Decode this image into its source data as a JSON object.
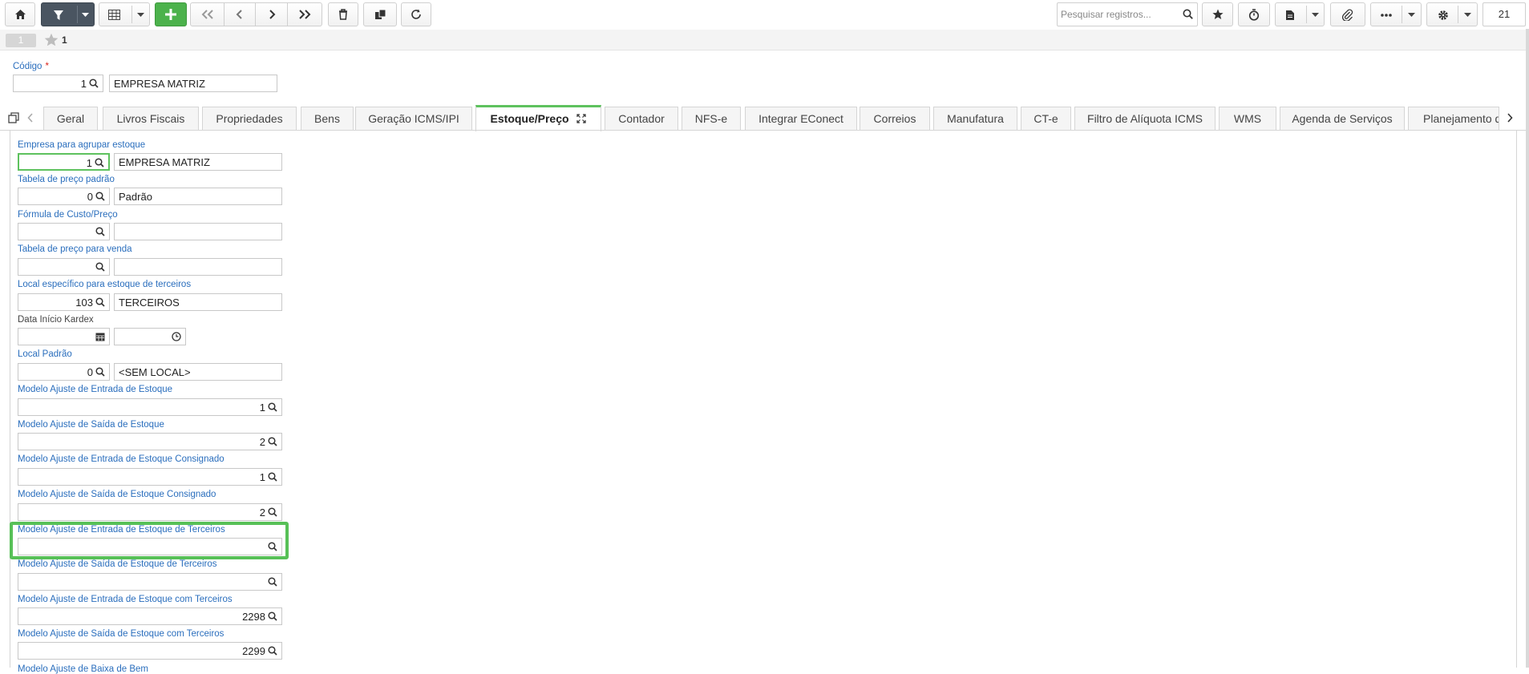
{
  "toolbar": {
    "search_placeholder": "Pesquisar registros...",
    "record_count": "21",
    "icons": [
      "home-icon",
      "filter-icon",
      "grid-icon",
      "plus-icon",
      "first-icon",
      "prev-icon",
      "next-icon",
      "last-icon",
      "trash-icon",
      "copy-icon",
      "refresh-icon",
      "star-icon",
      "stopwatch-icon",
      "report-icon",
      "paperclip-icon",
      "ellipsis-icon",
      "gear-icon"
    ]
  },
  "record_bar": {
    "pill": "1",
    "favorite_count": "1"
  },
  "header": {
    "codigo_label": "Código",
    "required_mark": "*",
    "codigo_value": "1",
    "codigo_desc": "EMPRESA MATRIZ"
  },
  "tabs": [
    {
      "label": "Geral"
    },
    {
      "label": "Livros Fiscais"
    },
    {
      "label": "Propriedades"
    },
    {
      "label": "Bens"
    },
    {
      "label": "Geração ICMS/IPI"
    },
    {
      "label": "Estoque/Preço",
      "active": true
    },
    {
      "label": "Contador"
    },
    {
      "label": "NFS-e"
    },
    {
      "label": "Integrar EConect"
    },
    {
      "label": "Correios"
    },
    {
      "label": "Manufatura"
    },
    {
      "label": "CT-e"
    },
    {
      "label": "Filtro de Alíquota ICMS"
    },
    {
      "label": "WMS"
    },
    {
      "label": "Agenda de Serviços"
    },
    {
      "label": "Planejamento d"
    }
  ],
  "fields": {
    "empresa_agrupar": {
      "label": "Empresa para agrupar estoque",
      "value": "1",
      "desc": "EMPRESA MATRIZ"
    },
    "tabela_preco_padrao": {
      "label": "Tabela de preço padrão",
      "value": "0",
      "desc": "Padrão"
    },
    "formula_custo": {
      "label": "Fórmula de Custo/Preço",
      "value": "",
      "desc": ""
    },
    "tabela_preco_venda": {
      "label": "Tabela de preço para venda",
      "value": "",
      "desc": ""
    },
    "local_terceiros": {
      "label": "Local específico para estoque de terceiros",
      "value": "103",
      "desc": "TERCEIROS"
    },
    "data_inicio_kardex": {
      "label": "Data Início Kardex",
      "date": "",
      "time": ""
    },
    "local_padrao": {
      "label": "Local Padrão",
      "value": "0",
      "desc": "<SEM LOCAL>"
    },
    "ajuste_entrada": {
      "label": "Modelo Ajuste de Entrada de Estoque",
      "value": "1"
    },
    "ajuste_saida": {
      "label": "Modelo Ajuste de Saída de Estoque",
      "value": "2"
    },
    "ajuste_entrada_consig": {
      "label": "Modelo Ajuste de Entrada de Estoque Consignado",
      "value": "1"
    },
    "ajuste_saida_consig": {
      "label": "Modelo Ajuste de Saída de Estoque Consignado",
      "value": "2"
    },
    "ajuste_entrada_de_terc": {
      "label": "Modelo Ajuste de Entrada de Estoque de Terceiros",
      "value": ""
    },
    "ajuste_saida_de_terc": {
      "label": "Modelo Ajuste de Saída de Estoque de Terceiros",
      "value": ""
    },
    "ajuste_entrada_com_terc": {
      "label": "Modelo Ajuste de Entrada de Estoque com Terceiros",
      "value": "2298"
    },
    "ajuste_saida_com_terc": {
      "label": "Modelo Ajuste de Saída de Estoque com Terceiros",
      "value": "2299"
    },
    "ajuste_baixa_bem": {
      "label": "Modelo Ajuste de Baixa de Bem"
    }
  },
  "colors": {
    "label_blue": "#2a6ebd",
    "accent_green": "#5ec25e",
    "toolbar_dark": "#4a5561",
    "add_green": "#4cb24c"
  }
}
